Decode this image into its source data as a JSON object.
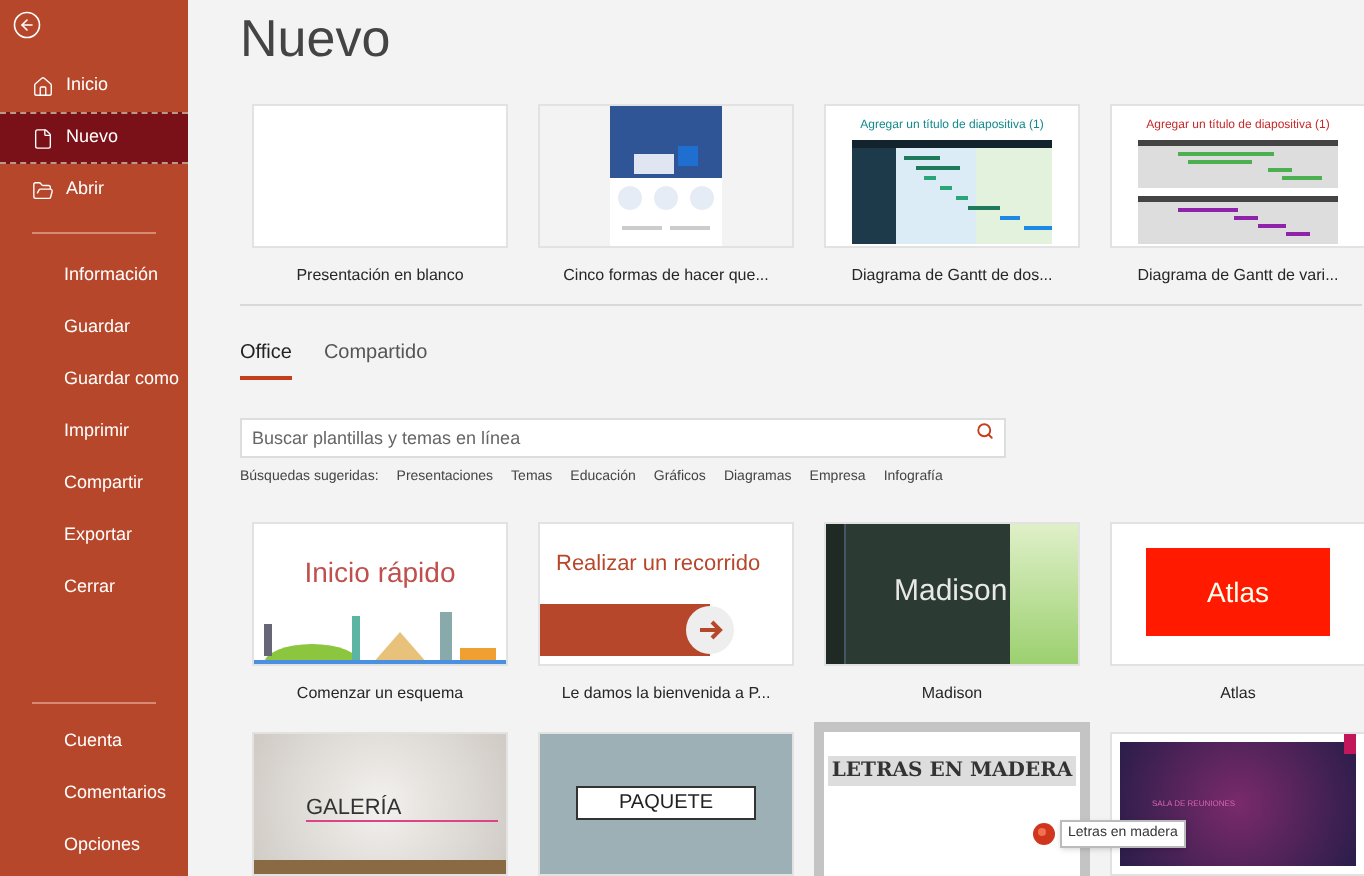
{
  "sidebar": {
    "primary": [
      {
        "label": "Inicio",
        "selected": false
      },
      {
        "label": "Nuevo",
        "selected": true
      },
      {
        "label": "Abrir",
        "selected": false
      }
    ],
    "secondary": [
      "Información",
      "Guardar",
      "Guardar como",
      "Imprimir",
      "Compartir",
      "Exportar",
      "Cerrar"
    ],
    "footer": [
      "Cuenta",
      "Comentarios",
      "Opciones"
    ]
  },
  "title": "Nuevo",
  "featured": [
    {
      "kind": "blank",
      "caption": "Presentación en blanco"
    },
    {
      "kind": "doc",
      "caption": "Cinco formas de hacer que..."
    },
    {
      "kind": "gantt",
      "text": "Agregar un título de diapositiva (1)",
      "caption": "Diagrama de Gantt de dos..."
    },
    {
      "kind": "gantt2",
      "text": "Agregar un título de diapositiva (1)",
      "caption": "Diagrama de Gantt de vari..."
    }
  ],
  "tabs": [
    {
      "label": "Office",
      "selected": true
    },
    {
      "label": "Compartido",
      "selected": false
    }
  ],
  "search": {
    "placeholder": "Buscar plantillas y temas en línea"
  },
  "suggestions": {
    "label": "Búsquedas sugeridas:",
    "items": [
      "Presentaciones",
      "Temas",
      "Educación",
      "Gráficos",
      "Diagramas",
      "Empresa",
      "Infografía"
    ]
  },
  "templates": [
    {
      "kind": "quickstart",
      "text": "Inicio rápido",
      "caption": "Comenzar un esquema",
      "hovered": false
    },
    {
      "kind": "tour",
      "text": "Realizar un recorrido",
      "caption": "Le damos la bienvenida a P...",
      "hovered": false
    },
    {
      "kind": "madison",
      "text": "Madison",
      "caption": "Madison",
      "hovered": false
    },
    {
      "kind": "atlas",
      "text": "Atlas",
      "caption": "Atlas",
      "hovered": false
    },
    {
      "kind": "galeria",
      "text": "GALERÍA",
      "hovered": false
    },
    {
      "kind": "paquete",
      "text": "PAQUETE",
      "hovered": false
    },
    {
      "kind": "madera",
      "text": "LETRAS EN MADERA",
      "hovered": true,
      "tooltip": "Letras en madera"
    },
    {
      "kind": "sala",
      "text": "SALA DE REUNIONES",
      "hovered": false
    }
  ]
}
